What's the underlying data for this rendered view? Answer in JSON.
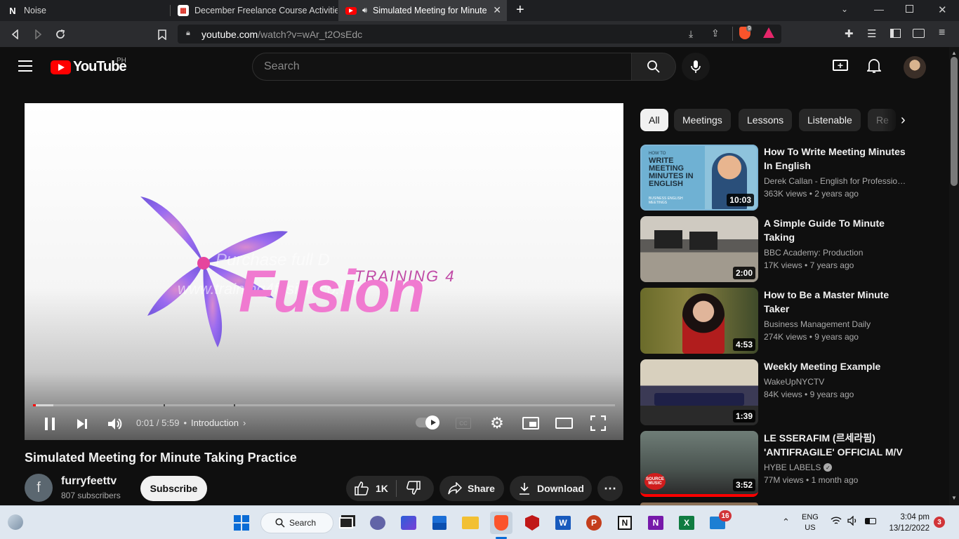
{
  "browser": {
    "tabs": [
      {
        "label": "Noise"
      },
      {
        "label": "December Freelance Course Activities"
      },
      {
        "label": "Simulated Meeting for Minute Taking Practice"
      }
    ],
    "url_host": "youtube.com",
    "url_path": "/watch?v=wAr_t2OsEdc",
    "brave_badge": "9"
  },
  "youtube": {
    "logo_text": "YouTube",
    "region": "PH",
    "search_placeholder": "Search"
  },
  "player": {
    "watermark_line1": "Purchase full D",
    "watermark_line2": "www.training4fusion.co.uk",
    "logo_small": "TRAINING 4",
    "logo_big": "Fusion",
    "time": "0:01 / 5:59",
    "separator": "•",
    "chapter": "Introduction",
    "progress_fraction": 0.003,
    "buffered_fraction": 0.035
  },
  "video": {
    "title": "Simulated Meeting for Minute Taking Practice",
    "channel_initial": "f",
    "channel": "furryfeettv",
    "subscribers": "807 subscribers",
    "subscribe_label": "Subscribe",
    "likes": "1K",
    "share_label": "Share",
    "download_label": "Download"
  },
  "chips": [
    "All",
    "Meetings",
    "Lessons",
    "Listenable",
    "Re"
  ],
  "recommendations": [
    {
      "title": "How To Write Meeting Minutes In English",
      "channel": "Derek Callan - English for Professionals",
      "views": "363K views",
      "age": "2 years ago",
      "duration": "10:03",
      "thumb_text1": "HOW TO",
      "thumb_text2": "WRITE MEETING MINUTES IN ENGLISH",
      "thumb_text3": "BUSINESS ENGLISH MEETINGS"
    },
    {
      "title": "A Simple Guide To Minute Taking",
      "channel": "BBC Academy: Production",
      "views": "17K views",
      "age": "7 years ago",
      "duration": "2:00"
    },
    {
      "title": "How to Be a Master Minute Taker",
      "channel": "Business Management Daily",
      "views": "274K views",
      "age": "9 years ago",
      "duration": "4:53"
    },
    {
      "title": "Weekly Meeting Example",
      "channel": "WakeUpNYCTV",
      "views": "84K views",
      "age": "9 years ago",
      "duration": "1:39"
    },
    {
      "title": "LE SSERAFIM (르세라핌) 'ANTIFRAGILE' OFFICIAL M/V",
      "channel": "HYBE LABELS",
      "views": "77M views",
      "age": "1 month ago",
      "duration": "3:52",
      "thumb_badge": "SOURCE MUSIC"
    }
  ],
  "meta_separator": "•",
  "taskbar": {
    "search_label": "Search",
    "lang1": "ENG",
    "lang2": "US",
    "time": "3:04 pm",
    "date": "13/12/2022",
    "notif_count": "3",
    "app_badge": "16"
  },
  "colors": {
    "yt_red": "#ff0000",
    "bg": "#0f0f0f",
    "progress": "#ff0000"
  }
}
